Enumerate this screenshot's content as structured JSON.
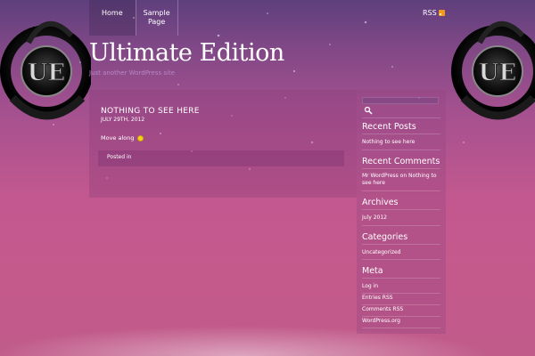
{
  "nav": {
    "items": [
      {
        "label": "Home"
      },
      {
        "label": "Sample Page"
      }
    ],
    "rss_label": "RSS"
  },
  "site": {
    "title": "Ultimate Edition",
    "tagline": "Just another WordPress site",
    "logo_text": "UE"
  },
  "post": {
    "title": "NOTHING TO SEE HERE",
    "date": "JULY 29TH, 2012",
    "body": "Move along",
    "meta": "Posted in"
  },
  "sidebar": {
    "recent_posts": {
      "title": "Recent Posts",
      "items": [
        "Nothing to see here"
      ]
    },
    "recent_comments": {
      "title": "Recent Comments",
      "items": [
        "Mr WordPress on Nothing to see here"
      ]
    },
    "archives": {
      "title": "Archives",
      "items": [
        "July 2012"
      ]
    },
    "categories": {
      "title": "Categories",
      "items": [
        "Uncategorized"
      ]
    },
    "meta": {
      "title": "Meta",
      "items": [
        "Log in",
        "Entries RSS",
        "Comments RSS",
        "WordPress.org"
      ]
    }
  },
  "colors": {
    "accent": "#c2588f",
    "rss": "#f39a1d"
  }
}
